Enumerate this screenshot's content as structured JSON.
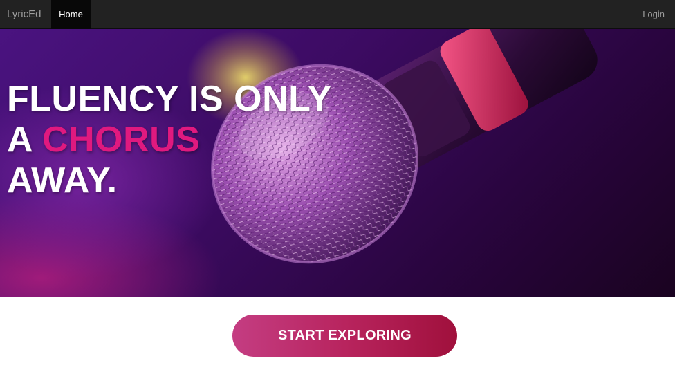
{
  "navbar": {
    "brand": "LyricEd",
    "home_label": "Home",
    "login_label": "Login"
  },
  "hero": {
    "line1": "FLUENCY IS ONLY",
    "line2_prefix": "A ",
    "line2_accent": "CHORUS",
    "line3": "AWAY.",
    "image": "microphone-photo"
  },
  "cta": {
    "label": "START EXPLORING"
  },
  "colors": {
    "navbar_bg": "#222222",
    "accent_pink": "#e0197f",
    "cta_start": "#c43d82",
    "cta_end": "#a0103c"
  }
}
